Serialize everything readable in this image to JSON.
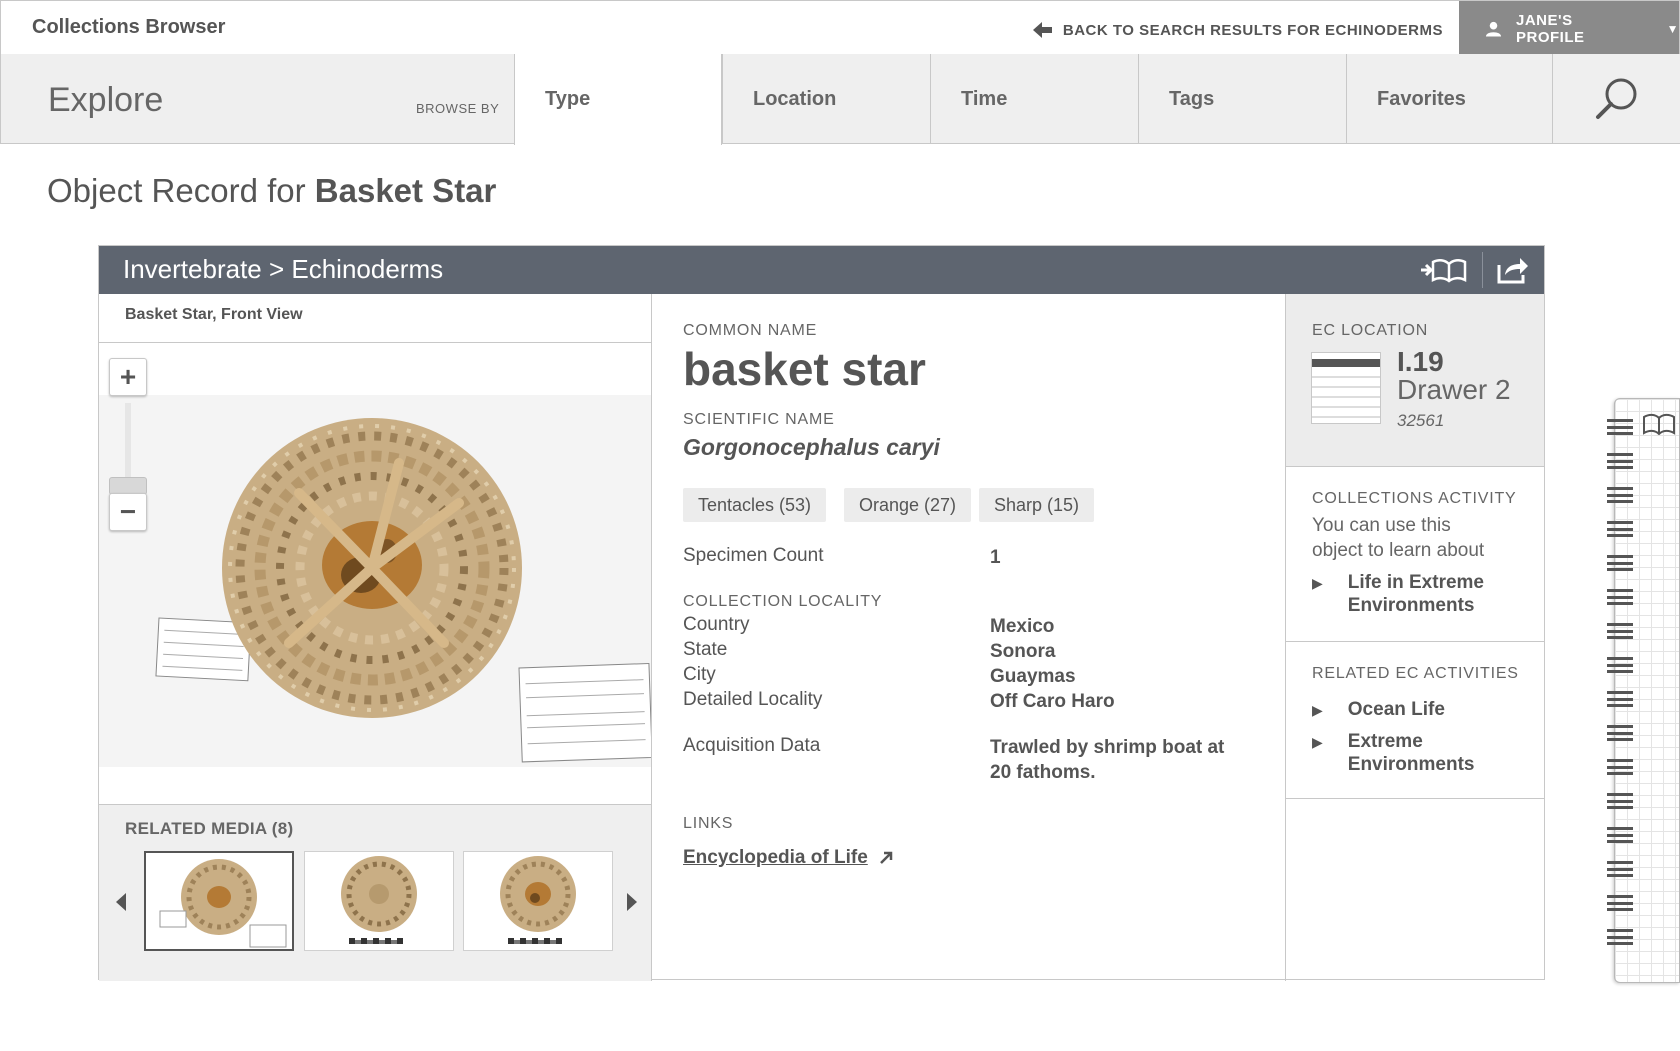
{
  "app": {
    "title": "Collections Browser"
  },
  "topbar": {
    "back_label": "BACK TO SEARCH RESULTS FOR ECHINODERMS",
    "profile_label": "JANE'S PROFILE"
  },
  "nav": {
    "explore": "Explore",
    "browse_by": "BROWSE BY",
    "tabs": [
      {
        "label": "Type",
        "active": true
      },
      {
        "label": "Location"
      },
      {
        "label": "Time"
      },
      {
        "label": "Tags"
      },
      {
        "label": "Favorites"
      }
    ],
    "search_icon": "search-icon"
  },
  "page": {
    "title_prefix": "Object Record for",
    "title_object": "Basket Star"
  },
  "record": {
    "breadcrumb": "Invertebrate > Echinoderms",
    "header_icons": [
      "add-to-notebook-icon",
      "share-icon"
    ],
    "view_label": "Basket Star, Front View",
    "zoom": {
      "in_label": "+",
      "out_label": "−",
      "level": 0.15
    },
    "related_media": {
      "label": "RELATED MEDIA (8)",
      "thumbnails": [
        {
          "name": "front-view",
          "selected": true
        },
        {
          "name": "top-view-scale"
        },
        {
          "name": "back-view-scale"
        }
      ]
    },
    "common_name_label": "COMMON NAME",
    "common_name": "basket star",
    "scientific_name_label": "SCIENTIFIC NAME",
    "scientific_name": "Gorgonocephalus caryi",
    "tags": [
      "Tentacles (53)",
      "Orange (27)",
      "Sharp (15)"
    ],
    "specimen_count_label": "Specimen Count",
    "specimen_count": "1",
    "locality_label": "COLLECTION LOCALITY",
    "locality": [
      {
        "key": "Country",
        "value": "Mexico"
      },
      {
        "key": "State",
        "value": "Sonora"
      },
      {
        "key": "City",
        "value": "Guaymas"
      },
      {
        "key": "Detailed Locality",
        "value": "Off Caro Haro"
      }
    ],
    "acquisition_label": "Acquisition Data",
    "acquisition_line1": "Trawled by shrimp boat at",
    "acquisition_line2": "20 fathoms.",
    "links_label": "LINKS",
    "link_eol": "Encyclopedia of Life"
  },
  "ec_location": {
    "label": "EC LOCATION",
    "code": "I.19",
    "drawer": "Drawer 2",
    "number": "32561"
  },
  "collections_activity": {
    "label": "COLLECTIONS ACTIVITY",
    "text_line1": "You can use this",
    "text_line2": "object to learn about",
    "link_line1": "Life in Extreme",
    "link_line2": "Environments"
  },
  "related_activities": {
    "label": "RELATED EC ACTIVITIES",
    "items": [
      {
        "line1": "Ocean Life",
        "line2": ""
      },
      {
        "line1": "Extreme",
        "line2": "Environments"
      }
    ]
  },
  "notebook": {
    "icon": "open-book-icon",
    "rings": 16
  },
  "colors": {
    "header_bg": "#5e6570",
    "profile_bg": "#8a8a8a",
    "nav_bg": "#efefef"
  }
}
